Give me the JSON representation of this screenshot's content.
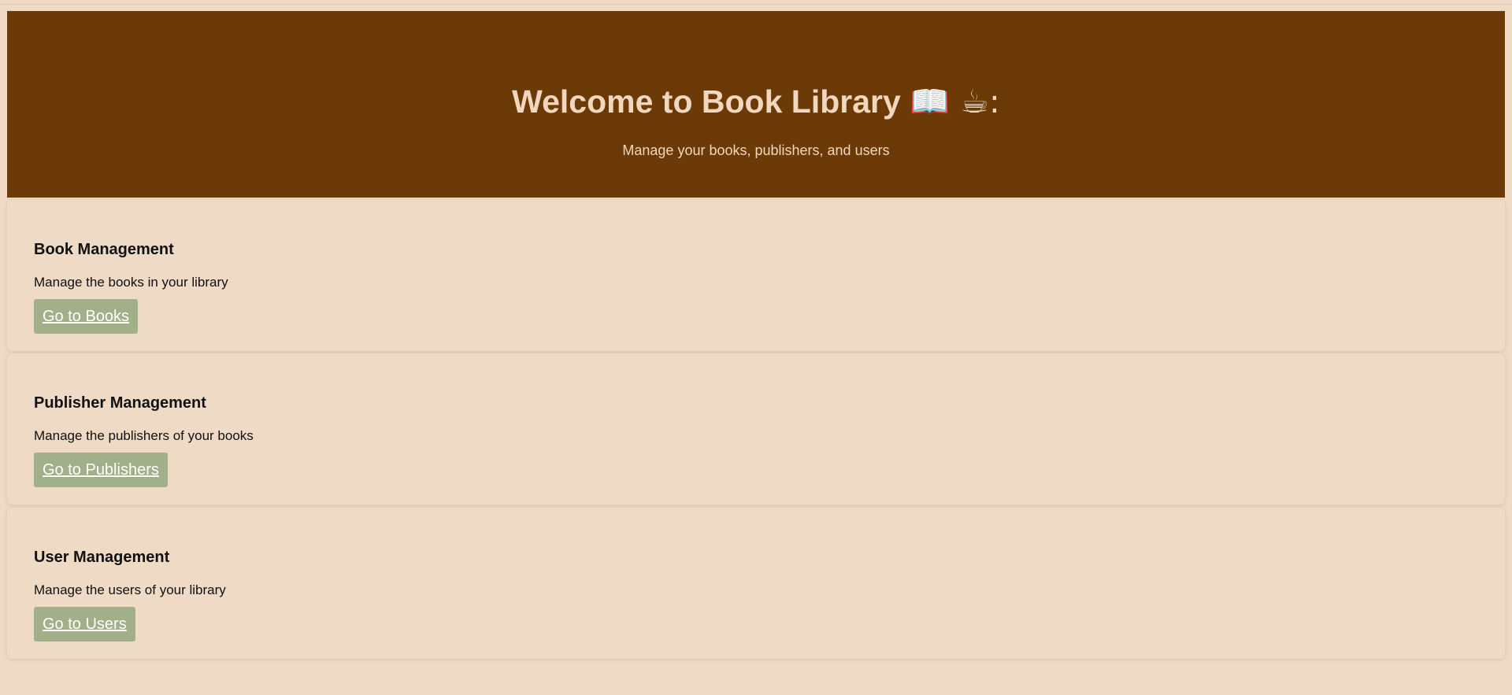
{
  "header": {
    "title": "Welcome to Book Library",
    "title_emoji": "📖 ☕:",
    "subtitle": "Manage your books, publishers, and users"
  },
  "cards": [
    {
      "title": "Book Management",
      "description": "Manage the books in your library",
      "button_label": "Go to Books"
    },
    {
      "title": "Publisher Management",
      "description": "Manage the publishers of your books",
      "button_label": "Go to Publishers"
    },
    {
      "title": "User Management",
      "description": "Manage the users of your library",
      "button_label": "Go to Users"
    }
  ],
  "colors": {
    "header_bg": "#6b3a06",
    "header_text": "#f1d7bd",
    "page_bg": "#eedac5",
    "button_bg": "#a1b088",
    "button_text": "#ffffff"
  }
}
